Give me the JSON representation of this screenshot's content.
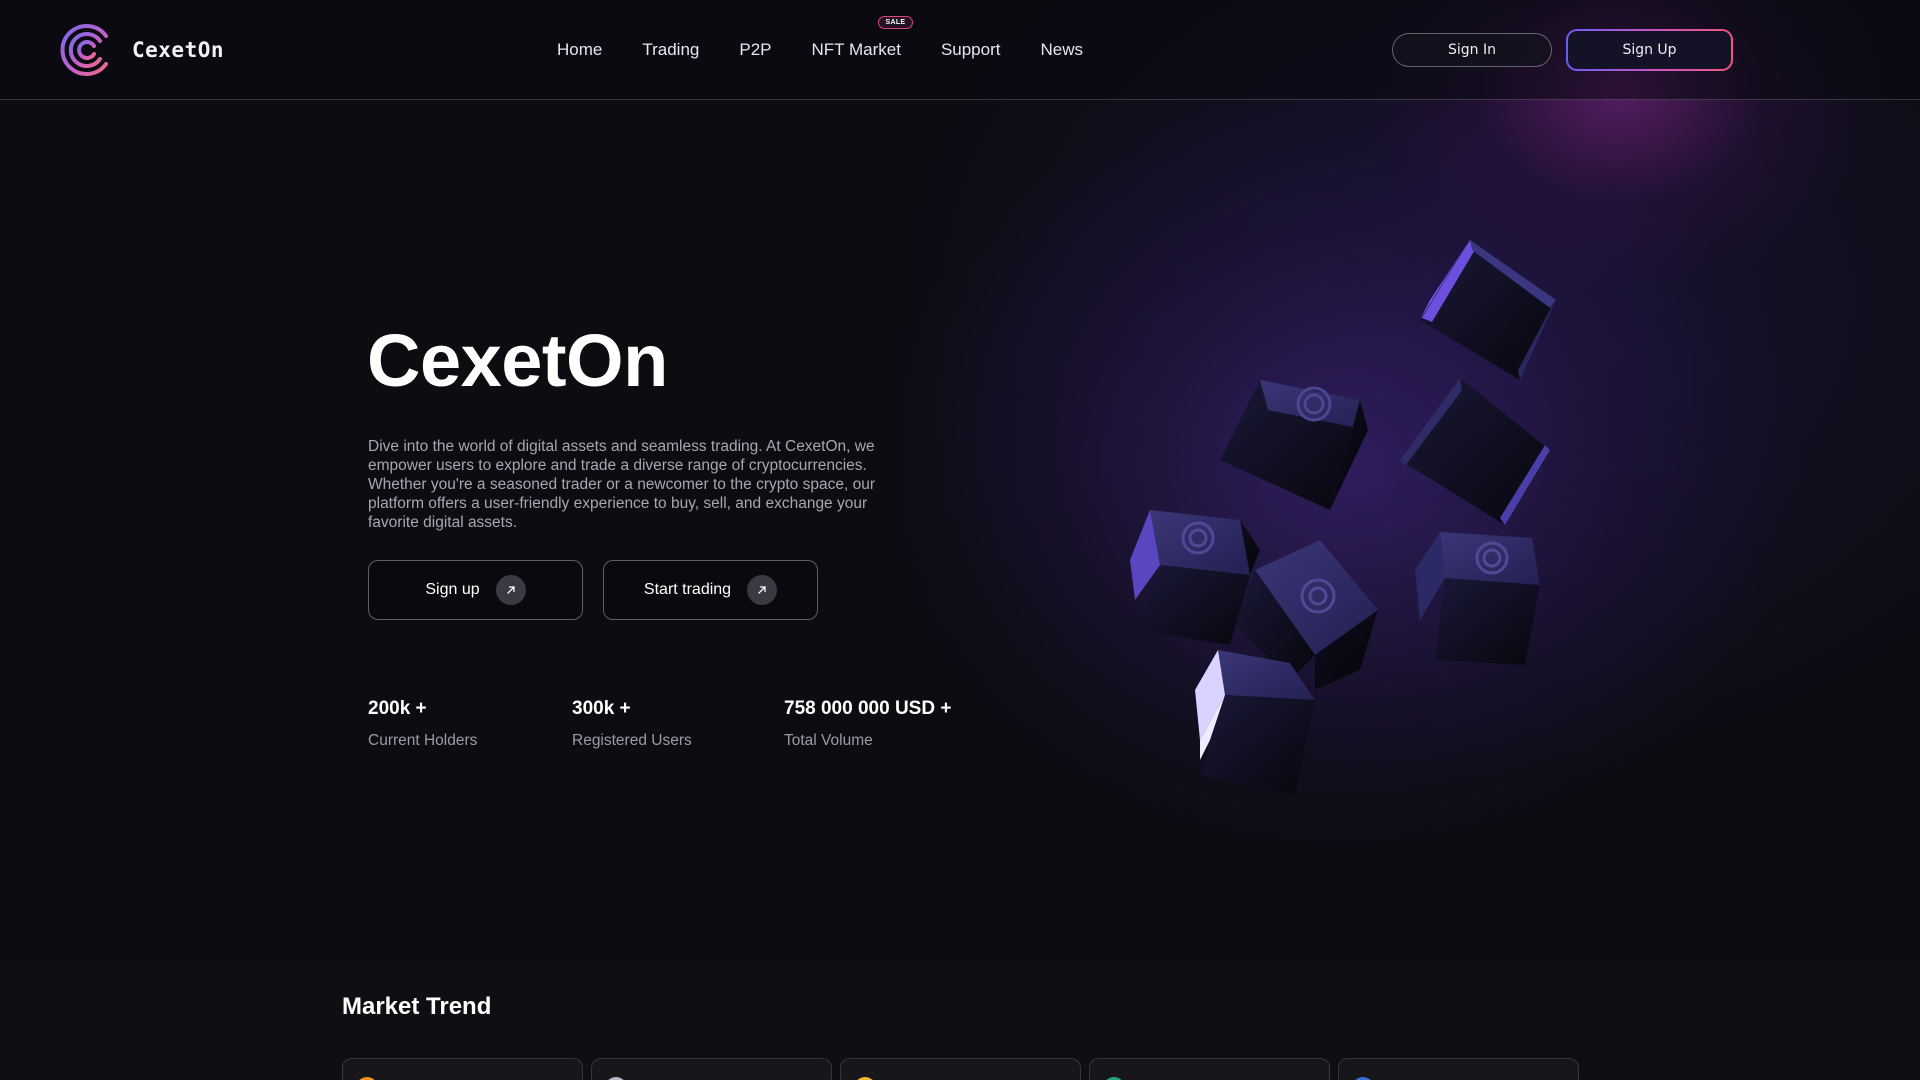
{
  "brand": {
    "name": "CexetOn"
  },
  "nav": {
    "items": [
      {
        "label": "Home"
      },
      {
        "label": "Trading"
      },
      {
        "label": "P2P"
      },
      {
        "label": "NFT Market",
        "badge": "SALE"
      },
      {
        "label": "Support"
      },
      {
        "label": "News"
      }
    ]
  },
  "header": {
    "sign_in_label": "Sign In",
    "sign_up_label": "Sign Up"
  },
  "hero": {
    "title": "CexetOn",
    "description": "Dive into the world of digital assets and seamless trading. At CexetOn, we empower users to explore and trade a diverse range of cryptocurrencies. Whether you're a seasoned trader or a newcomer to the crypto space, our platform offers a user-friendly experience to buy, sell, and exchange your favorite digital assets.",
    "cta_signup": "Sign up",
    "cta_trading": "Start trading"
  },
  "stats": [
    {
      "value": "200k +",
      "label": "Current Holders"
    },
    {
      "value": "300k +",
      "label": "Registered Users"
    },
    {
      "value": "758 000 000 USD +",
      "label": "Total Volume"
    }
  ],
  "market": {
    "title": "Market Trend",
    "cards": [
      {
        "name": "",
        "color": "#f7931a"
      },
      {
        "name": "",
        "color": "#b8b8c4"
      },
      {
        "name": "",
        "color": "#f3ba2f"
      },
      {
        "name": "",
        "color": "#26a17b"
      },
      {
        "name": "",
        "color": "#3b6fd8"
      }
    ]
  },
  "colors": {
    "accent_purple": "#6a5cf5",
    "accent_pink": "#f0567d",
    "sale_badge": "#d9457f",
    "background": "#0c0c11"
  },
  "icons": {
    "logo": "cexeton-logo-icon",
    "cta_arrow": "arrow-up-right-icon",
    "cube": "cube-icon"
  }
}
